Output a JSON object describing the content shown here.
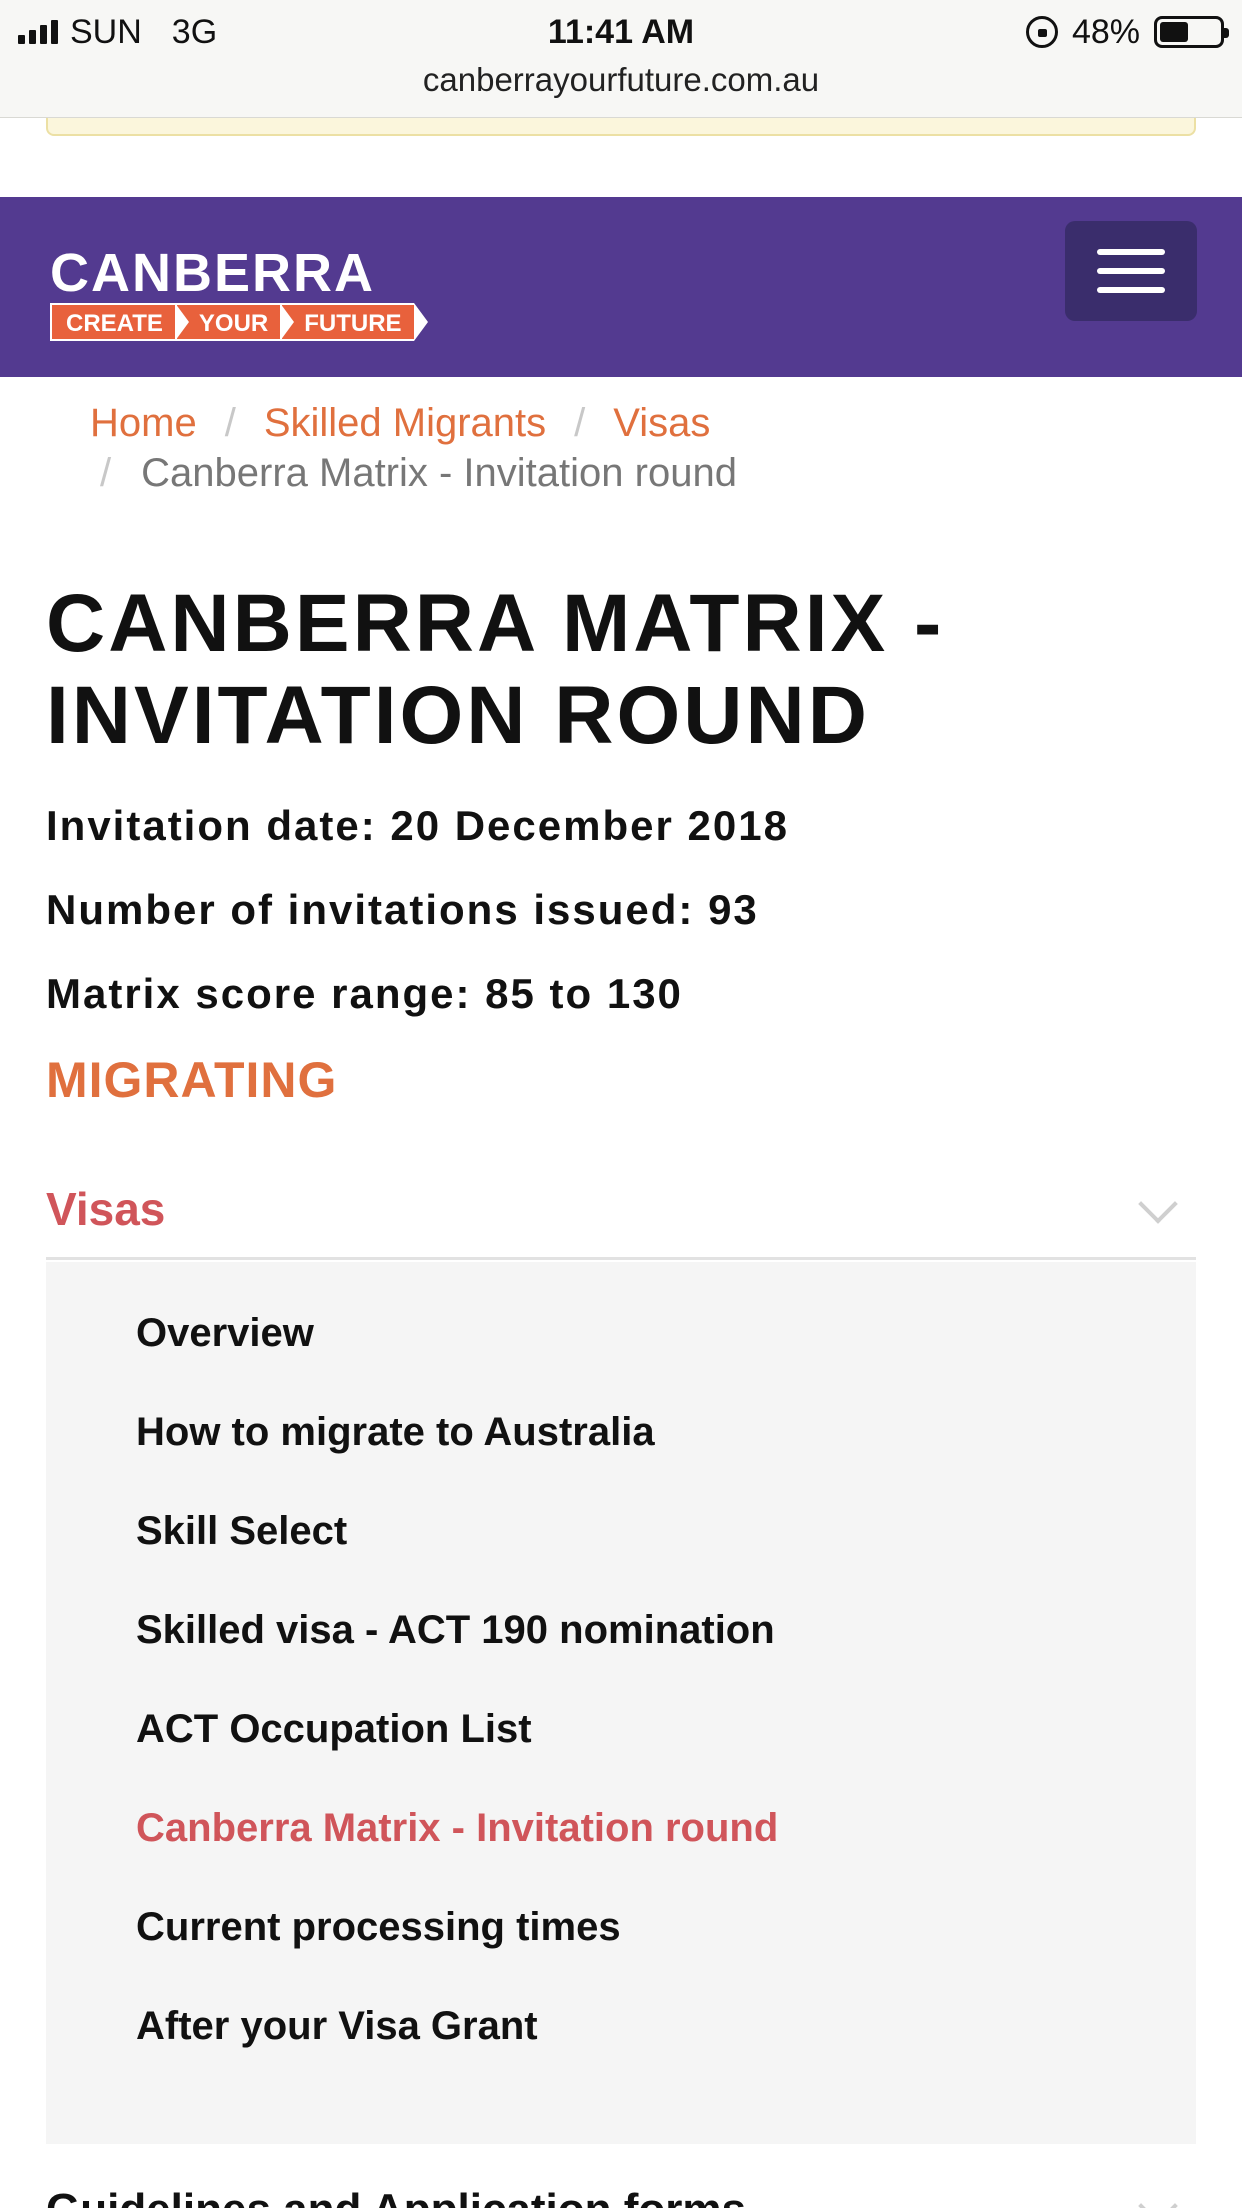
{
  "status_bar": {
    "carrier": "SUN",
    "network": "3G",
    "time": "11:41 AM",
    "battery": "48%",
    "battery_level": 0.48,
    "url": "canberrayourfuture.com.au"
  },
  "header": {
    "logo_word": "CANBERRA",
    "logo_tagline": [
      "CREATE",
      "YOUR",
      "FUTURE"
    ],
    "menu_icon": "hamburger-icon",
    "brand_color": "#533a90",
    "accent_color": "#e0703e"
  },
  "breadcrumb": {
    "items": [
      "Home",
      "Skilled Migrants",
      "Visas"
    ],
    "current": "Canberra Matrix - Invitation round"
  },
  "main": {
    "title_line1": "CANBERRA MATRIX -",
    "title_line2": "INVITATION ROUND",
    "invitation_date": "Invitation date:  20 December 2018",
    "invitations_issued": "Number of invitations issued: 93",
    "score_range": "Matrix score range: 85 to 130"
  },
  "sidebar": {
    "heading": "MIGRATING",
    "section": "Visas",
    "items": [
      {
        "label": "Overview",
        "active": false
      },
      {
        "label": "How to migrate to Australia",
        "active": false
      },
      {
        "label": "Skill Select",
        "active": false
      },
      {
        "label": "Skilled visa - ACT 190 nomination",
        "active": false
      },
      {
        "label": "ACT Occupation List",
        "active": false
      },
      {
        "label": "Canberra Matrix - Invitation round",
        "active": true
      },
      {
        "label": "Current processing times",
        "active": false
      },
      {
        "label": "After your Visa Grant",
        "active": false
      }
    ],
    "next_section": "Guidelines and Application forms"
  }
}
